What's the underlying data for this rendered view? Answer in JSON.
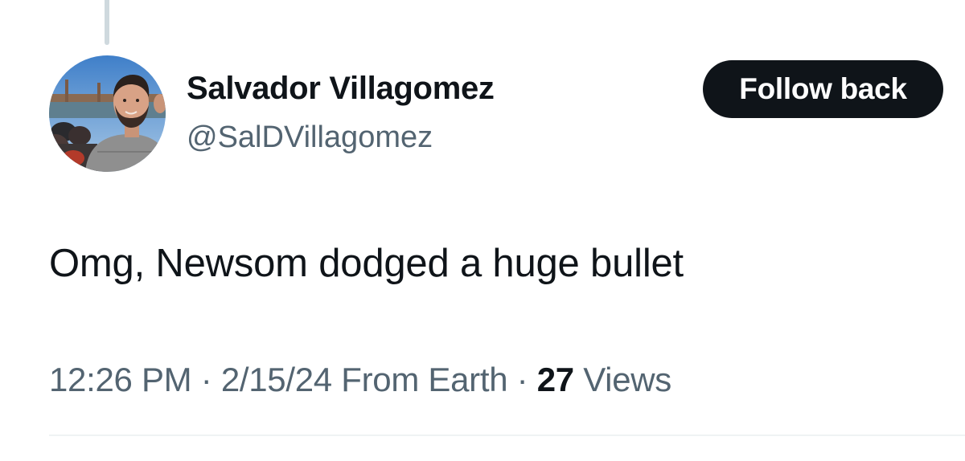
{
  "author": {
    "display_name": "Salvador Villagomez",
    "handle": "@SalDVillagomez"
  },
  "actions": {
    "follow_label": "Follow back"
  },
  "tweet": {
    "text": "Omg, Newsom dodged a huge bullet"
  },
  "meta": {
    "time": "12:26 PM",
    "separator": "·",
    "date": "2/15/24",
    "source": "From Earth",
    "views_count": "27",
    "views_label": "Views"
  },
  "colors": {
    "primary_text": "#0f1419",
    "secondary_text": "#536471",
    "button_bg": "#0f1419",
    "thread_line": "#cfd9de",
    "divider": "#eff3f4"
  },
  "icons": {
    "avatar": "profile-photo"
  }
}
